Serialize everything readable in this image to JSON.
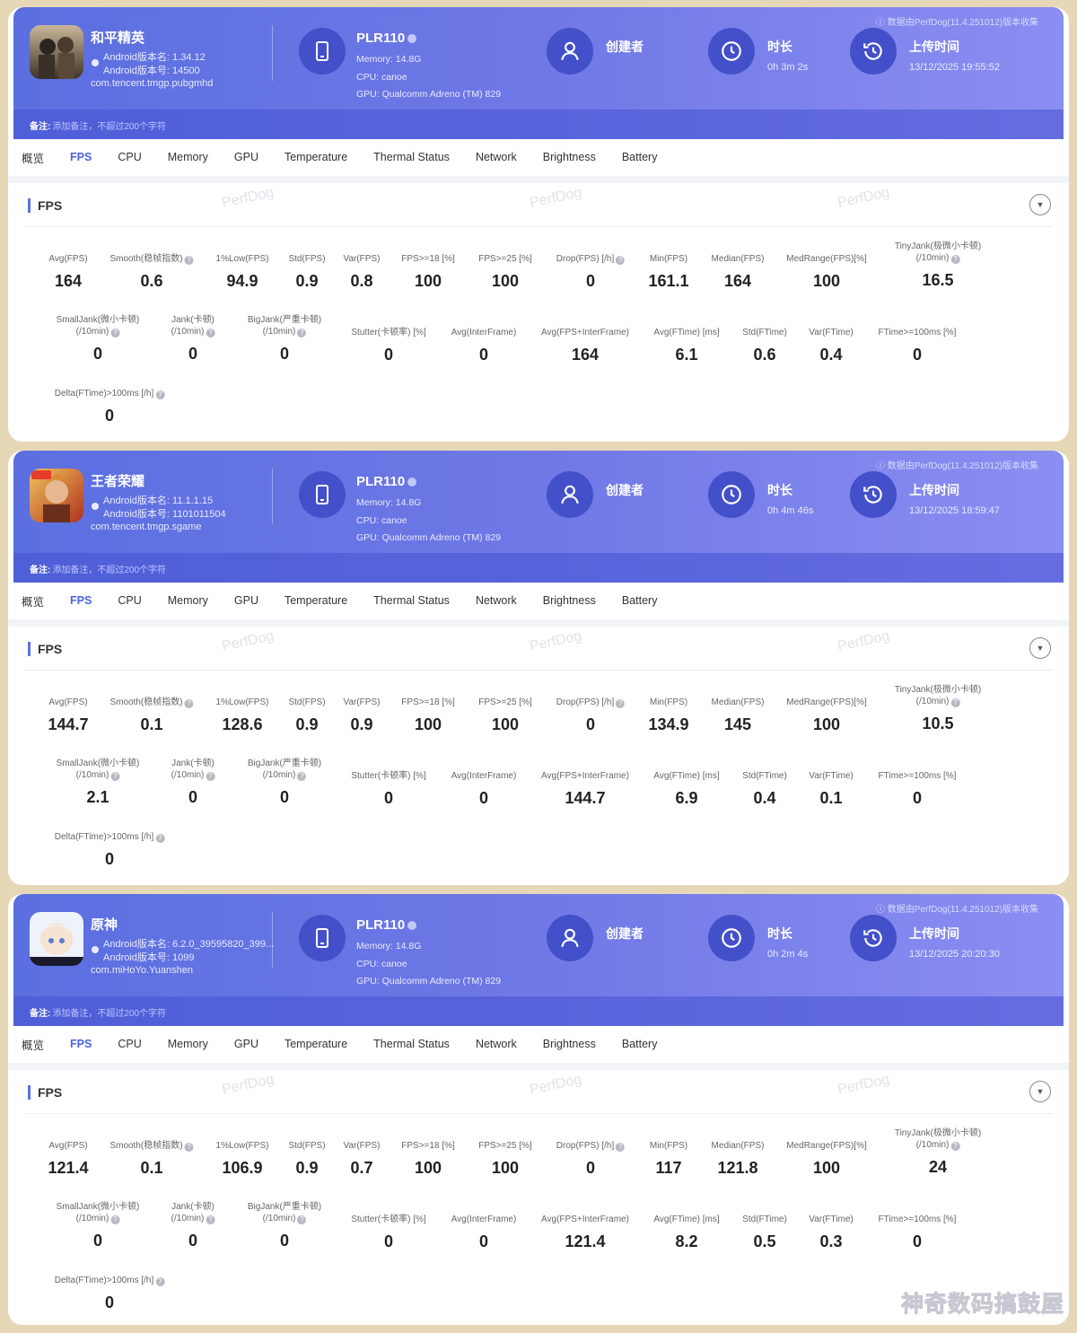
{
  "colors": {
    "header_start": "#5b6fe0",
    "header_end": "#8b8ef2",
    "accent": "#4a63e0",
    "page_bg": "#e6d8b6"
  },
  "tabs": [
    "概览",
    "FPS",
    "CPU",
    "Memory",
    "GPU",
    "Temperature",
    "Thermal Status",
    "Network",
    "Brightness",
    "Battery"
  ],
  "remark": {
    "label": "备注:",
    "placeholder": "添加备注，不超过200个字符"
  },
  "collect_note": "数据由PerfDog(11.4.251012)版本收集",
  "device": {
    "name": "PLR110",
    "memory": "Memory: 14.8G",
    "cpu": "CPU: canoe",
    "gpu": "GPU: Qualcomm Adreno (TM) 829"
  },
  "labels": {
    "creator": "创建者",
    "duration": "时长",
    "upload": "上传时间",
    "fps_section": "FPS",
    "watermark": "PerfDog"
  },
  "metric_labels": {
    "avg_fps": "Avg(FPS)",
    "smooth": "Smooth(稳帧指数)",
    "low1": "1%Low(FPS)",
    "std_fps": "Std(FPS)",
    "var_fps": "Var(FPS)",
    "fps18": "FPS>=18 [%]",
    "fps25": "FPS>=25 [%]",
    "drop": "Drop(FPS) [/h]",
    "min_fps": "Min(FPS)",
    "median_fps": "Median(FPS)",
    "medrange": "MedRange(FPS)[%]",
    "tinyjank": "TinyJank(极微小卡顿)",
    "per10": "(/10min)",
    "smalljank": "SmallJank(微小卡顿)",
    "jank": "Jank(卡顿)",
    "bigjank": "BigJank(严重卡顿)",
    "stutter": "Stutter(卡顿率) [%]",
    "avg_inter": "Avg(InterFrame)",
    "avg_fps_inter": "Avg(FPS+InterFrame)",
    "avg_ftime": "Avg(FTime) [ms]",
    "std_ftime": "Std(FTime)",
    "var_ftime": "Var(FTime)",
    "ftime100": "FTime>=100ms [%]",
    "delta": "Delta(FTime)>100ms [/h]"
  },
  "games": [
    {
      "name": "和平精英",
      "android_ver": "Android版本名: 1.34.12",
      "android_build": "Android版本号: 14500",
      "package": "com.tencent.tmgp.pubgmhd",
      "duration": "0h 3m 2s",
      "upload_time": "13/12/2025 19:55:52",
      "metrics": {
        "avg_fps": "164",
        "smooth": "0.6",
        "low1": "94.9",
        "std_fps": "0.9",
        "var_fps": "0.8",
        "fps18": "100",
        "fps25": "100",
        "drop": "0",
        "min_fps": "161.1",
        "median_fps": "164",
        "medrange": "100",
        "tinyjank": "16.5",
        "smalljank": "0",
        "jank": "0",
        "bigjank": "0",
        "stutter": "0",
        "avg_inter": "0",
        "avg_fps_inter": "164",
        "avg_ftime": "6.1",
        "std_ftime": "0.6",
        "var_ftime": "0.4",
        "ftime100": "0",
        "delta": "0"
      }
    },
    {
      "name": "王者荣耀",
      "android_ver": "Android版本名: 11.1.1.15",
      "android_build": "Android版本号: 1101011504",
      "package": "com.tencent.tmgp.sgame",
      "duration": "0h 4m 46s",
      "upload_time": "13/12/2025 18:59:47",
      "metrics": {
        "avg_fps": "144.7",
        "smooth": "0.1",
        "low1": "128.6",
        "std_fps": "0.9",
        "var_fps": "0.9",
        "fps18": "100",
        "fps25": "100",
        "drop": "0",
        "min_fps": "134.9",
        "median_fps": "145",
        "medrange": "100",
        "tinyjank": "10.5",
        "smalljank": "2.1",
        "jank": "0",
        "bigjank": "0",
        "stutter": "0",
        "avg_inter": "0",
        "avg_fps_inter": "144.7",
        "avg_ftime": "6.9",
        "std_ftime": "0.4",
        "var_ftime": "0.1",
        "ftime100": "0",
        "delta": "0"
      }
    },
    {
      "name": "原神",
      "android_ver": "Android版本名: 6.2.0_39595820_399...",
      "android_build": "Android版本号: 1099",
      "package": "com.miHoYo.Yuanshen",
      "duration": "0h 2m 4s",
      "upload_time": "13/12/2025 20:20:30",
      "metrics": {
        "avg_fps": "121.4",
        "smooth": "0.1",
        "low1": "106.9",
        "std_fps": "0.9",
        "var_fps": "0.7",
        "fps18": "100",
        "fps25": "100",
        "drop": "0",
        "min_fps": "117",
        "median_fps": "121.8",
        "medrange": "100",
        "tinyjank": "24",
        "smalljank": "0",
        "jank": "0",
        "bigjank": "0",
        "stutter": "0",
        "avg_inter": "0",
        "avg_fps_inter": "121.4",
        "avg_ftime": "8.2",
        "std_ftime": "0.5",
        "var_ftime": "0.3",
        "ftime100": "0",
        "delta": "0"
      }
    }
  ],
  "footer_watermark": "神奇数码搞鼓屋"
}
